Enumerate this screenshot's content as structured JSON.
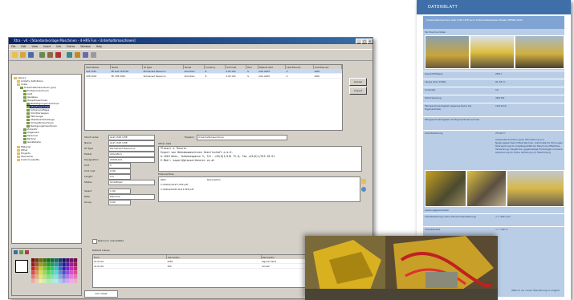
{
  "window": {
    "title": "Xtra - v4 - [Standardvorlage Maschinen - 4-HRS Fun - Unterhaltsmaschinen]",
    "menu": [
      "File",
      "Edit",
      "View",
      "Insert",
      "Info",
      "Extras",
      "Window",
      "Help"
    ]
  },
  "tree": [
    "Library",
    "Activity definitions",
    "Costs",
    "Unterhaltsmaschinen (Juli)",
    "Einbaumaschinen",
    "AAZ",
    "Gleisbau",
    "Hauptmaschinen",
    "Befestigungsmaschinen",
    "Stopfmaschinen",
    "Schienenpflege",
    "Schotterwagen",
    "Fahrzeuge",
    "Stabilisierfahrzeuge",
    "Schweißmaschinen",
    "Reinigungsmaschinen",
    "Zubehör",
    "Allgemein",
    "Personal",
    "Partner",
    "Geräteteile",
    "Material",
    "Other",
    "Projects",
    "Standorte",
    "Custom palette"
  ],
  "grid": {
    "columns": [
      "Short Name",
      "Name",
      "ID Type",
      "Model",
      "Currency",
      "Unit Cost",
      "Pool",
      "Default valid",
      "Last Planned",
      "Cost Planned"
    ],
    "rows": [
      [
        "ALZ 1325",
        "PE ALZ 1325 PR",
        "Permanent Resource",
        "Allocation",
        "€",
        "0.00 100",
        "%",
        "AUG 2009",
        "0",
        "1000"
      ],
      [
        "UHP 2002",
        "PE UHP 2002",
        "Permanent Resource",
        "Allocation",
        "€",
        "0.00 100",
        "%",
        "AUG 2009",
        "0",
        "1000"
      ]
    ],
    "buttons": [
      "Cancel",
      "Import"
    ]
  },
  "form": {
    "labels": [
      "Short name",
      "Name",
      "ID Type",
      "Model",
      "Designation",
      "Unit",
      "Unit cost",
      "Length",
      "Status",
      "Select",
      "Rate",
      "Group"
    ],
    "short_name": "ALZ 1325 UHP",
    "name": "ALZ 1325 UHP",
    "id_type": "Permanent Resource",
    "model": "Allocation",
    "designation": "20091101",
    "unit": "h",
    "unit_cost": "0.00",
    "length": "0.0",
    "status": "Undefined",
    "select": "1.00",
    "rate": "Machine",
    "group": "0.00",
    "expand_label": "Expand",
    "expand_value": "Unterhaltsmaschinen",
    "contact_header": "Other data",
    "contact_lines": [
      "Plasser & Theurer",
      "Export von Bahnbaumaschinen Gesellschaft m.b.H.",
      "A-1010 Wien, Johannesgasse 3, Tel. +43(0)1/515 72-0, Fax +43(0)1/513 18 01",
      "E-Mail: export@plassertheurer.co.at"
    ],
    "file_header": "External files",
    "file_columns": [
      "Path",
      "Description"
    ],
    "files": [
      "C:\\Daten\\ALZ 1325.pdf",
      "C:\\Datenblatt ALZ 1325.pdf"
    ],
    "checkbox": "Resource unavailable",
    "detail_header": "Default values",
    "detail_columns": [
      "From",
      "Calculation",
      "Description"
    ],
    "detail_rows": [
      [
        "01.01.09",
        "2050",
        "Eigener Fahrt"
      ],
      [
        "01.01.09",
        "350",
        "Schnell"
      ]
    ],
    "tab": "Info sheet"
  },
  "datasheet": {
    "header": "DATENBLATT",
    "title": "Unterhaltsmaschine ALZ 1325 UHP auch Unterhaltsarbeiten Breite UPFIER 2002",
    "section": "Technische Daten",
    "rows": [
      [
        "Gewicht/Masse",
        "280 t"
      ],
      [
        "Länge über Puffer",
        "91,35 m"
      ],
      [
        "Achszahl",
        "19"
      ],
      [
        "Motorleistung",
        "380 kW"
      ],
      [
        "Fahrgeschwindigkeit (eigenes Ruhe bis Eigenantrieb)",
        "100 km/h"
      ],
      [
        "Fahrgeschwindigkeit mit Eigenantrieb schnee"
      ],
      [
        "Arbeitsleistung",
        "25.00 m"
      ]
    ],
    "desc": "Automatische Führung für Überhöhung und Neigungswechsel mittels Rechner. Automatische Führungen Überwachung für Arbeitsqualität der Maschine (Pfeilhöhe, Verwindung, Längshöhe, gegenseitige Höhenlage) inclusive Absicherung für Höhe, Richtung und Überhöhung",
    "section2": "Leistungsparameter",
    "rows2": [
      [
        "Arbeitsleistung (ohne Planumsherstellung)",
        ">= 300 m/h"
      ],
      [
        "Arbeitsbreite",
        ">= 700 m"
      ]
    ],
    "footnote": "(800 m) vor neuen Überhöhung so möglich"
  },
  "colors": {
    "title_start": "#0a246a",
    "title_end": "#3a6ea5",
    "sheet_header": "#3f6fa8",
    "sheet_bg": "#b9cde6"
  }
}
